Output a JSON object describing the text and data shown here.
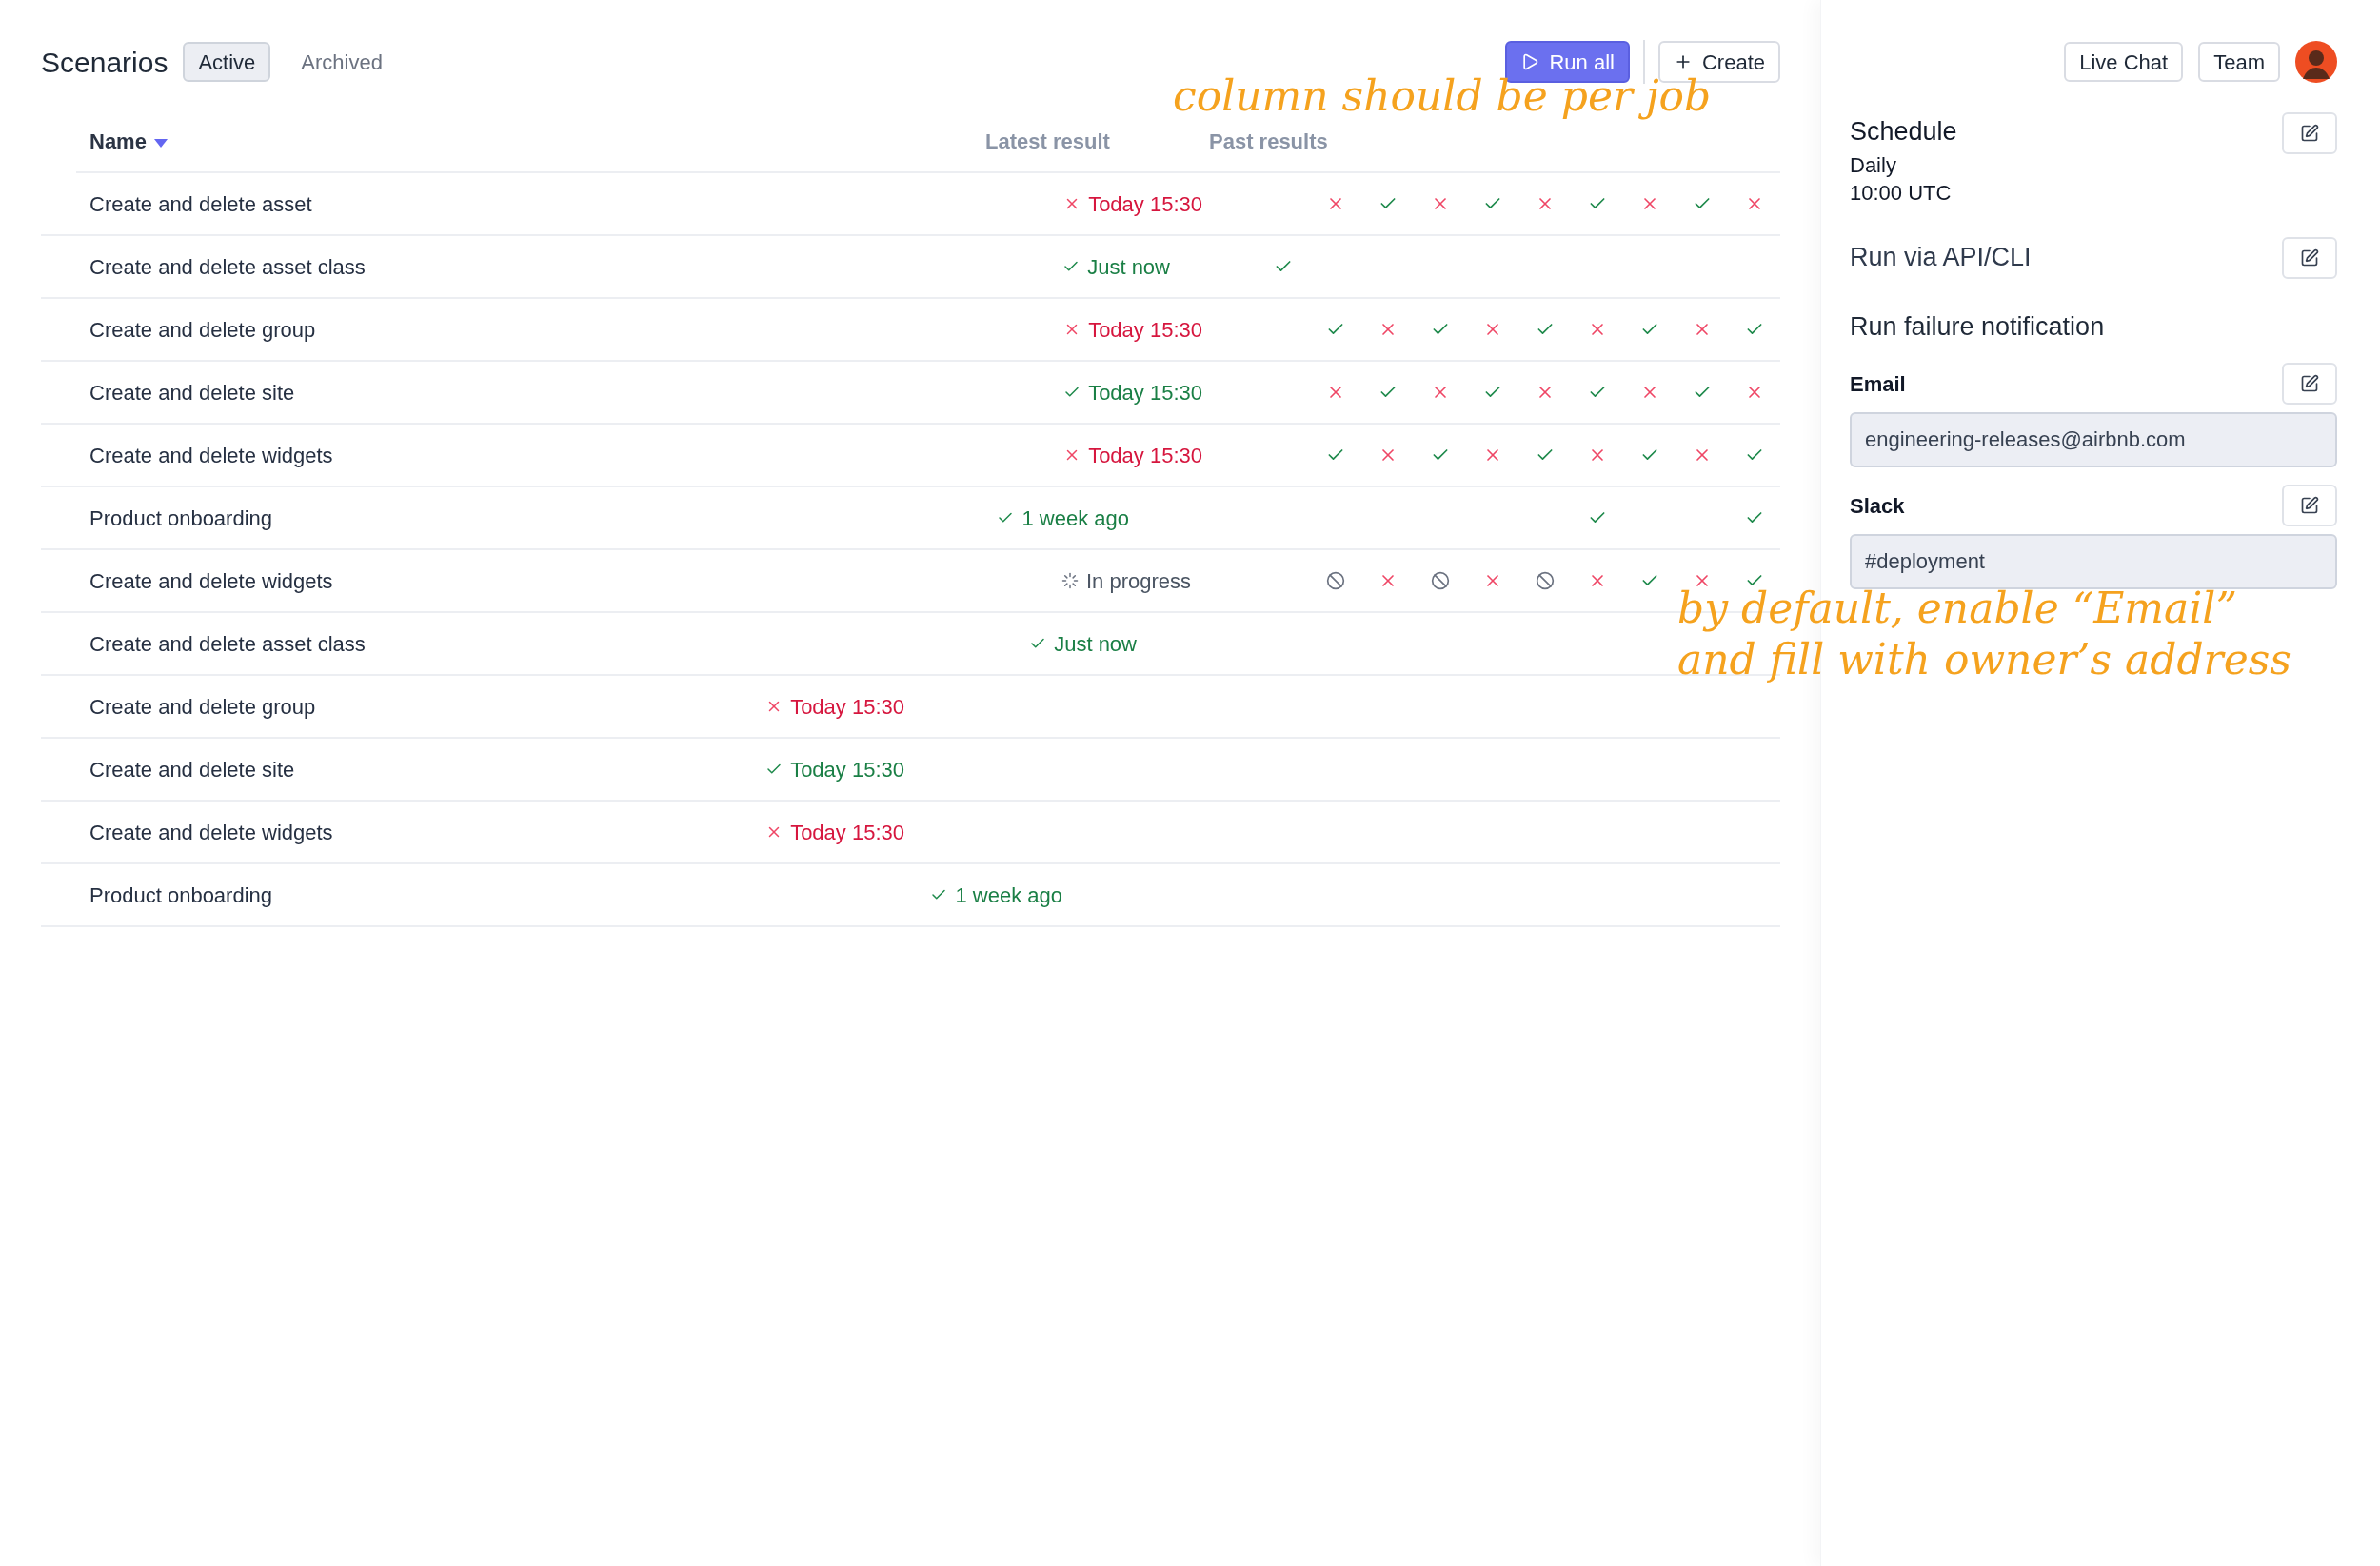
{
  "header": {
    "title": "Scenarios",
    "tabs": [
      {
        "label": "Active",
        "selected": true
      },
      {
        "label": "Archived",
        "selected": false
      }
    ]
  },
  "actions": [
    {
      "label": "Run all",
      "kind": "primary"
    },
    {
      "label": "Create",
      "kind": "secondary"
    }
  ],
  "table": {
    "columns": [
      {
        "label": "Name",
        "sorted": true
      },
      {
        "label": "Latest result",
        "sorted": false
      },
      {
        "label": "Past results",
        "sorted": false
      }
    ],
    "rows": [
      {
        "name": "Create and delete asset",
        "latest": {
          "kind": "fail",
          "text": "Today 15:30"
        },
        "past": [
          {
            "kind": "empty"
          },
          {
            "kind": "fail"
          },
          {
            "kind": "pass"
          },
          {
            "kind": "fail"
          },
          {
            "kind": "pass"
          },
          {
            "kind": "fail"
          },
          {
            "kind": "pass"
          },
          {
            "kind": "fail"
          },
          {
            "kind": "pass"
          },
          {
            "kind": "fail"
          }
        ]
      },
      {
        "name": "Create and delete asset class",
        "latest": {
          "kind": "pass",
          "text": "Just now"
        },
        "past": [
          {
            "kind": "pass"
          }
        ]
      },
      {
        "name": "Create and delete group",
        "latest": {
          "kind": "fail",
          "text": "Today 15:30"
        },
        "past": [
          {
            "kind": "empty"
          },
          {
            "kind": "pass"
          },
          {
            "kind": "fail"
          },
          {
            "kind": "pass"
          },
          {
            "kind": "fail"
          },
          {
            "kind": "pass"
          },
          {
            "kind": "fail"
          },
          {
            "kind": "pass"
          },
          {
            "kind": "fail"
          },
          {
            "kind": "pass"
          }
        ]
      },
      {
        "name": "Create and delete site",
        "latest": {
          "kind": "pass",
          "text": "Today 15:30"
        },
        "past": [
          {
            "kind": "empty"
          },
          {
            "kind": "fail"
          },
          {
            "kind": "pass"
          },
          {
            "kind": "fail"
          },
          {
            "kind": "pass"
          },
          {
            "kind": "fail"
          },
          {
            "kind": "pass"
          },
          {
            "kind": "fail"
          },
          {
            "kind": "pass"
          },
          {
            "kind": "fail"
          }
        ]
      },
      {
        "name": "Create and delete widgets",
        "latest": {
          "kind": "fail",
          "text": "Today 15:30"
        },
        "past": [
          {
            "kind": "empty"
          },
          {
            "kind": "pass"
          },
          {
            "kind": "fail"
          },
          {
            "kind": "pass"
          },
          {
            "kind": "fail"
          },
          {
            "kind": "pass"
          },
          {
            "kind": "fail"
          },
          {
            "kind": "pass"
          },
          {
            "kind": "fail"
          },
          {
            "kind": "pass"
          }
        ]
      },
      {
        "name": "Product onboarding",
        "latest": {
          "kind": "pass",
          "text": "1 week ago"
        },
        "past": [
          {
            "kind": "empty"
          },
          {
            "kind": "empty"
          },
          {
            "kind": "empty"
          },
          {
            "kind": "empty"
          },
          {
            "kind": "empty"
          },
          {
            "kind": "empty"
          },
          {
            "kind": "pass"
          },
          {
            "kind": "empty"
          },
          {
            "kind": "empty"
          },
          {
            "kind": "pass"
          }
        ]
      },
      {
        "name": "Create and delete widgets",
        "latest": {
          "kind": "running",
          "text": "In progress"
        },
        "past": [
          {
            "kind": "empty"
          },
          {
            "kind": "skipped"
          },
          {
            "kind": "fail"
          },
          {
            "kind": "skipped"
          },
          {
            "kind": "fail"
          },
          {
            "kind": "skipped"
          },
          {
            "kind": "fail"
          },
          {
            "kind": "pass"
          },
          {
            "kind": "fail"
          },
          {
            "kind": "pass"
          }
        ]
      },
      {
        "name": "Create and delete asset class",
        "latest": {
          "kind": "pass",
          "text": "Just now"
        }
      },
      {
        "name": "Create and delete group",
        "latest": {
          "kind": "fail",
          "text": "Today 15:30"
        }
      },
      {
        "name": "Create and delete site",
        "latest": {
          "kind": "pass",
          "text": "Today 15:30"
        }
      },
      {
        "name": "Create and delete widgets",
        "latest": {
          "kind": "fail",
          "text": "Today 15:30"
        }
      },
      {
        "name": "Product onboarding",
        "latest": {
          "kind": "pass",
          "text": "1 week ago"
        }
      }
    ]
  },
  "sidebar": {
    "top_buttons": [
      "Live Chat",
      "Team"
    ],
    "schedule": {
      "title": "Schedule",
      "lines": [
        "Daily",
        "10:00 UTC"
      ]
    },
    "api": {
      "title": "Run via API/CLI"
    },
    "notification": {
      "title": "Run failure notification",
      "channels": [
        {
          "label": "Email",
          "value": "engineering-releases@airbnb.com"
        },
        {
          "label": "Slack",
          "value": "#deployment"
        }
      ]
    }
  },
  "annotations": [
    {
      "lines": [
        "column should be per job"
      ]
    },
    {
      "lines": [
        "by default, enable “Email”",
        "and fill with owner’s address"
      ]
    }
  ]
}
